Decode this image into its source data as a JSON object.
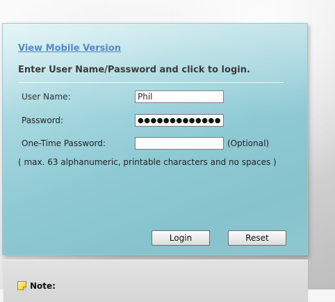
{
  "login_panel": {
    "mobile_link": "View Mobile Version",
    "instruction": "Enter User Name/Password and click to login.",
    "username": {
      "label": "User Name:",
      "value": "Phil"
    },
    "password": {
      "label": "Password:",
      "value": "●●●●●●●●●●●●●"
    },
    "otp": {
      "label": "One-Time Password:",
      "value": "",
      "optional_text": "(Optional)"
    },
    "hint": "( max. 63 alphanumeric, printable characters and no spaces )",
    "buttons": {
      "login": "Login",
      "reset": "Reset"
    }
  },
  "note": {
    "label": "Note:",
    "icon": "note-icon"
  },
  "colors": {
    "panel": "#8fcad4",
    "link": "#1a5fb4"
  }
}
